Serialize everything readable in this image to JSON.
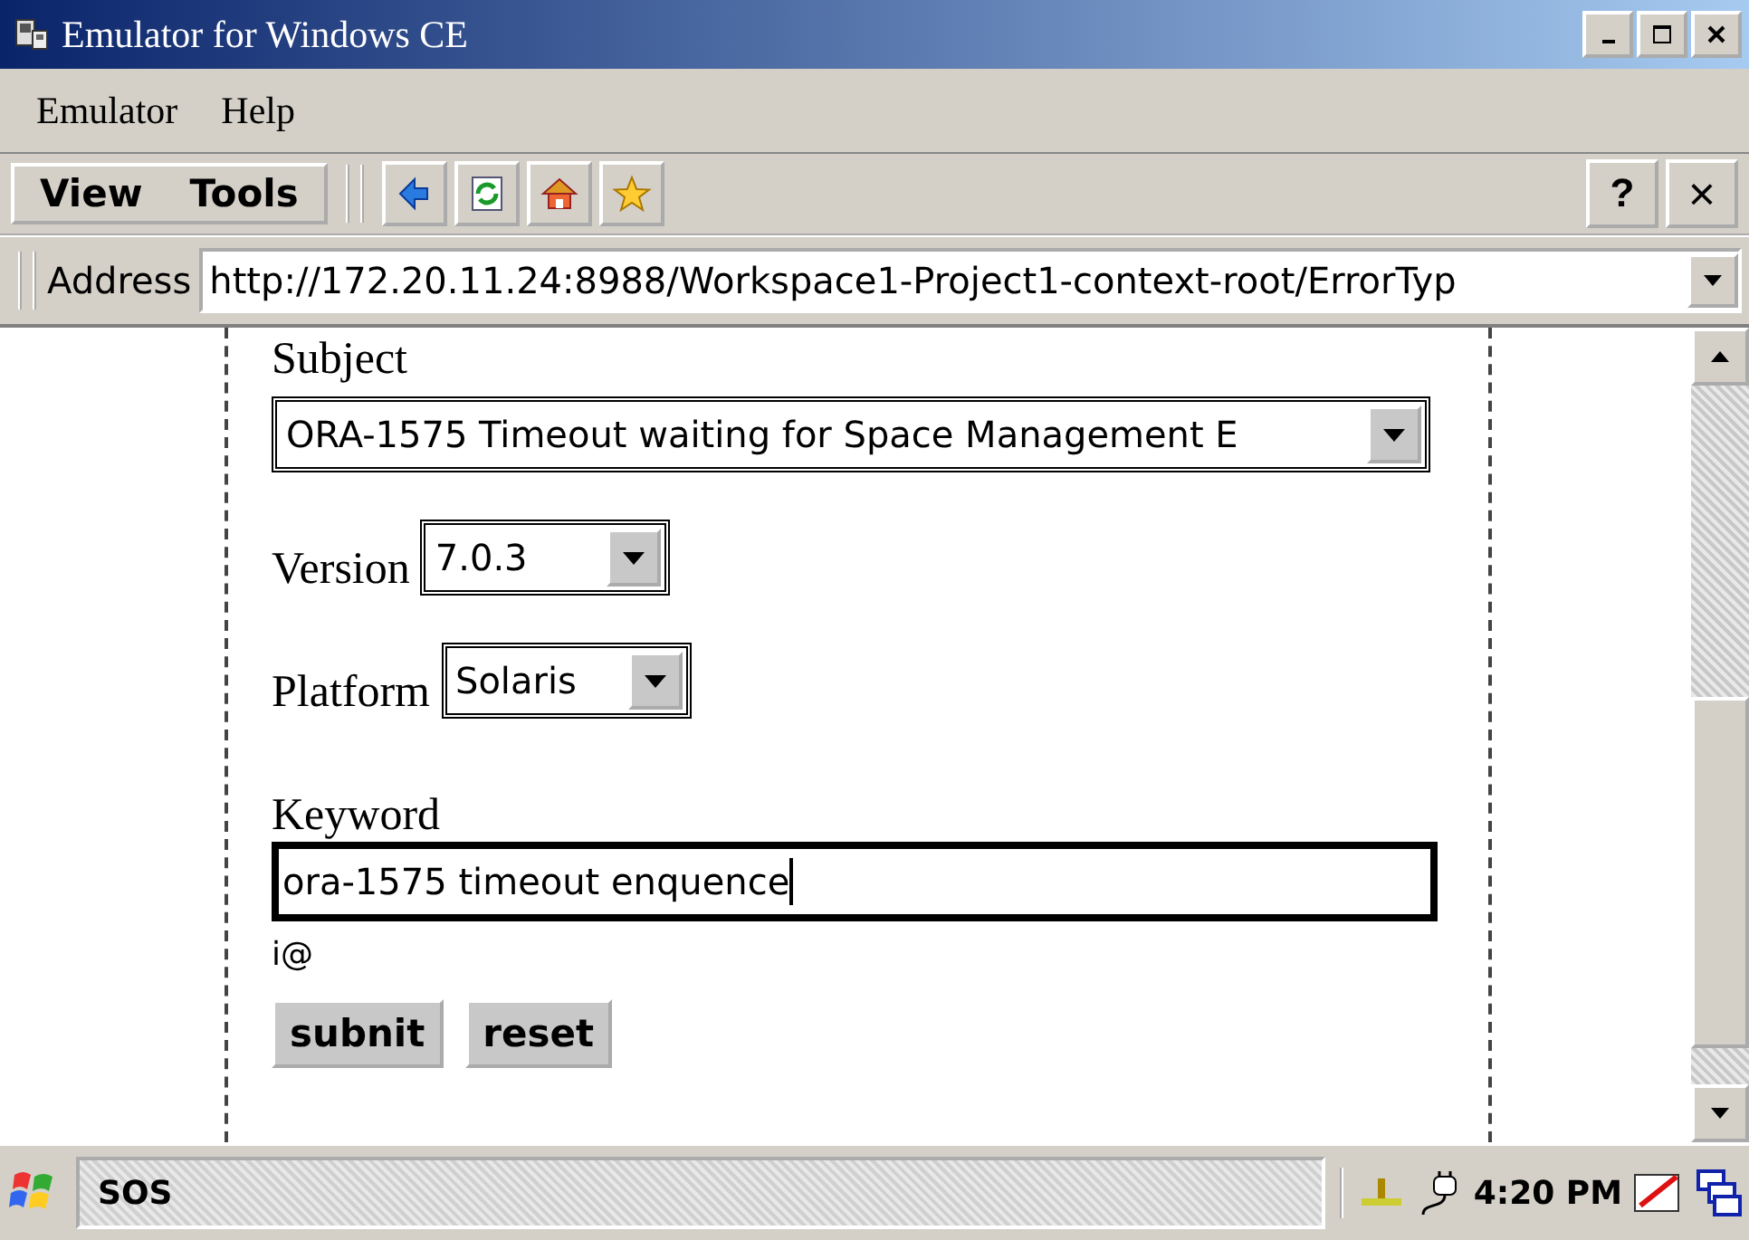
{
  "window": {
    "title": "Emulator for Windows CE"
  },
  "menu": [
    "Emulator",
    "Help"
  ],
  "command_bar": {
    "menus": [
      "View",
      "Tools"
    ],
    "help": "?",
    "close": "×"
  },
  "address_bar": {
    "label": "Address",
    "url": "http://172.20.11.24:8988/Workspace1-Project1-context-root/ErrorTyp"
  },
  "form": {
    "subject": {
      "label": "Subject",
      "value": "ORA-1575 Timeout waiting for Space Management E"
    },
    "version": {
      "label": "Version",
      "value": "7.0.3"
    },
    "platform": {
      "label": "Platform",
      "value": "Solaris"
    },
    "keyword": {
      "label": "Keyword",
      "value": "ora-1575 timeout enquence"
    },
    "input_mode": "i@",
    "buttons": [
      "subnit",
      "reset"
    ]
  },
  "taskbar": {
    "task": "SOS",
    "time": "4:20 PM"
  }
}
